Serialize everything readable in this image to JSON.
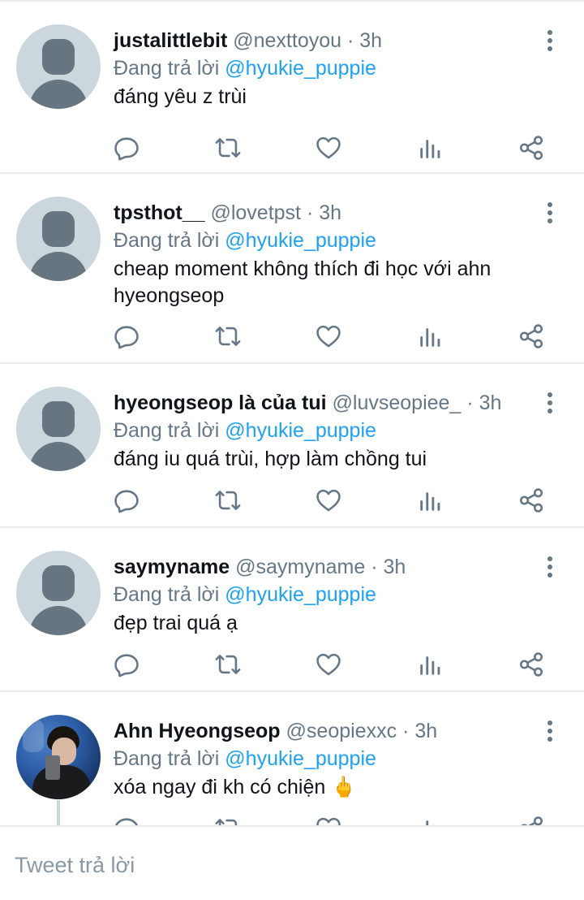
{
  "reply_prefix": "Đang trả lời",
  "replies": [
    {
      "name": "justalittlebit",
      "handle": "@nexttoyou",
      "time": "· 3h",
      "mention": "@hyukie_puppie",
      "text": "đáng yêu z trùi",
      "avatar": "default-avatar"
    },
    {
      "name": "tpsthot__",
      "handle": "@lovetpst",
      "time": "· 3h",
      "mention": "@hyukie_puppie",
      "text": "cheap moment không thích đi học với ahn hyeongseop",
      "avatar": "default-avatar"
    },
    {
      "name": "hyeongseop là của tui",
      "handle": "@luvseopiee_",
      "time": "· 3h",
      "mention": "@hyukie_puppie",
      "text": "đáng iu quá trùi, hợp làm chồng tui",
      "avatar": "default-avatar"
    },
    {
      "name": "saymyname",
      "handle": "@saymyname",
      "time": "· 3h",
      "mention": "@hyukie_puppie",
      "text": "đẹp trai quá ạ",
      "avatar": "default-avatar"
    },
    {
      "name": "Ahn Hyeongseop",
      "handle": "@seopiexxc",
      "time": "· 3h",
      "mention": "@hyukie_puppie",
      "text": "xóa ngay đi kh có chiện 🖕",
      "avatar": "profile-photo"
    }
  ],
  "icons": [
    "reply-icon",
    "retweet-icon",
    "like-icon",
    "analytics-icon",
    "share-icon",
    "more-options-icon"
  ],
  "colors": {
    "link": "#1da1f2",
    "secondary": "#657786",
    "divider": "#e6ecf0",
    "text": "#0f1419"
  },
  "compose": {
    "placeholder": "Tweet trả lời"
  }
}
